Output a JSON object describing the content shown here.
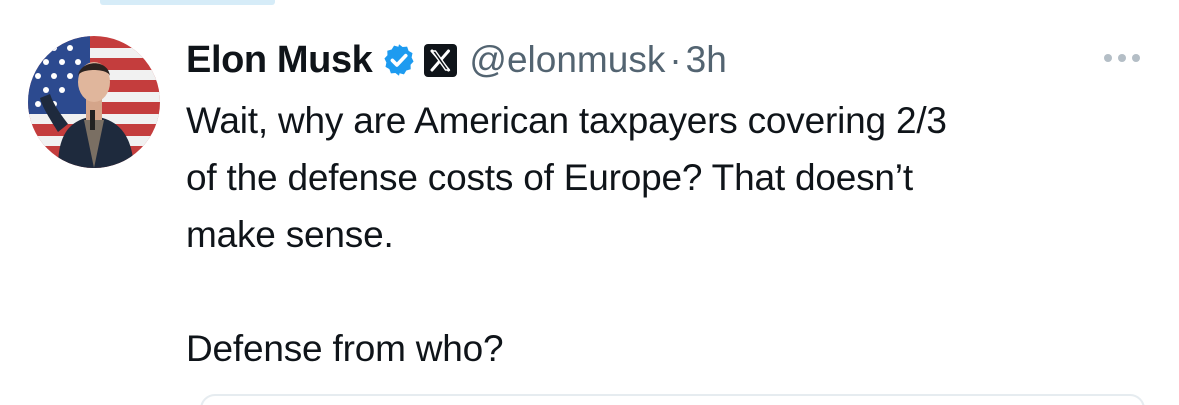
{
  "post": {
    "author": {
      "display_name": "Elon Musk",
      "handle": "@elonmusk",
      "verified": true,
      "avatar_icon": "profile-photo-flag-background"
    },
    "separator": "·",
    "timestamp": "3h",
    "text": "Wait, why are American taxpayers covering 2/3\nof the defense costs of Europe? That doesn’t\nmake sense.\n\nDefense from who?",
    "icons": {
      "verified": "verified-badge-icon",
      "platform": "x-logo-icon",
      "menu": "more-options-icon"
    },
    "colors": {
      "text": "#0f1419",
      "secondary": "#536471",
      "verified_blue": "#1d9bf0"
    }
  }
}
